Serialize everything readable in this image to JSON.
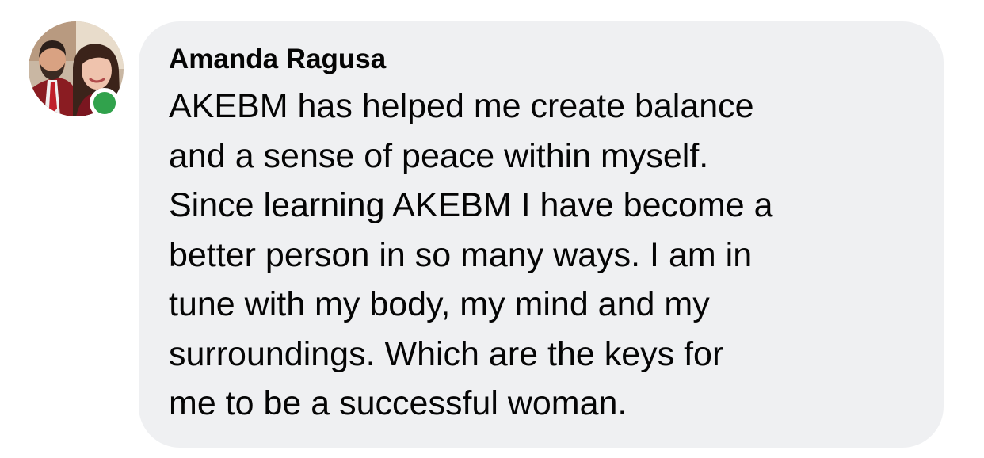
{
  "comment": {
    "author": "Amanda Ragusa",
    "online": true,
    "lines": [
      "AKEBM has helped me create balance",
      "and a sense of peace within myself.",
      "Since learning AKEBM I have become a",
      "better person in so many ways. I am in",
      "tune with my body, my mind and my",
      "surroundings. Which are the keys for",
      "me to be a successful woman."
    ]
  },
  "colors": {
    "bubble_background": "#eff0f2",
    "text": "#050505",
    "presence": "#31a24c"
  },
  "icons": {
    "avatar": "profile-photo-avatar",
    "presence": "online-status-dot"
  }
}
